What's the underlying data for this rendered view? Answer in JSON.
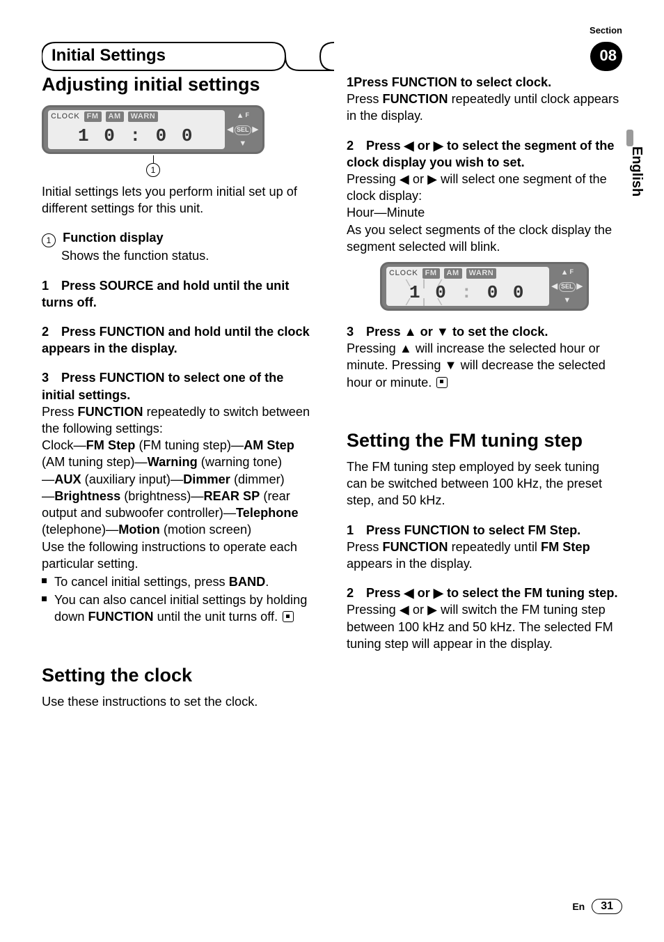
{
  "header": {
    "section_label": "Section",
    "title": "Initial Settings",
    "section_number": "08"
  },
  "language_tab": "English",
  "left": {
    "h_adjusting": "Adjusting initial settings",
    "lcd1": {
      "clock_label": "CLOCK",
      "chips": [
        "FM",
        "AM",
        "WARN"
      ],
      "time": "1 0 : 0 0",
      "sel": "SEL",
      "f": "F",
      "callout": "1"
    },
    "intro": "Initial settings lets you perform initial set up of different settings for this unit.",
    "fn_display_num": "1",
    "fn_display_title": "Function display",
    "fn_display_body": "Shows the function status.",
    "s1_n": "1",
    "s1": "Press SOURCE and hold until the unit turns off.",
    "s2_n": "2",
    "s2": "Press FUNCTION and hold until the clock appears in the display.",
    "s3_n": "3",
    "s3": "Press FUNCTION to select one of the initial settings.",
    "s3_body_a": "Press ",
    "s3_body_b": "FUNCTION",
    "s3_body_c": " repeatedly to switch between the following settings:",
    "chain": {
      "p1a": "Clock—",
      "p1b": "FM Step",
      "p1c": " (FM tuning step)—",
      "p1d": "AM Step",
      "p2a": "(AM tuning step)—",
      "p2b": "Warning",
      "p2c": " (warning tone)",
      "p3a": "—",
      "p3b": "AUX",
      "p3c": " (auxiliary input)—",
      "p3d": "Dimmer",
      "p3e": " (dimmer)",
      "p4a": "—",
      "p4b": "Brightness",
      "p4c": " (brightness)—",
      "p4d": "REAR SP",
      "p4e": " (rear",
      "p5a": "output and subwoofer controller)—",
      "p5b": "Telephone",
      "p6a": "(telephone)—",
      "p6b": "Motion",
      "p6c": " (motion screen)"
    },
    "use_following": "Use the following instructions to operate each particular setting.",
    "bullet1a": "To cancel initial settings, press ",
    "bullet1b": "BAND",
    "bullet1c": ".",
    "bullet2a": "You can also cancel initial settings by holding down ",
    "bullet2b": "FUNCTION",
    "bullet2c": " until the unit turns off.",
    "h_clock": "Setting the clock",
    "clock_intro": "Use these instructions to set the clock."
  },
  "right": {
    "r1_n": "1",
    "r1_t": "Press FUNCTION to select clock.",
    "r1_a": "Press ",
    "r1_b": "FUNCTION",
    "r1_c": " repeatedly until clock appears in the display.",
    "r2_n": "2",
    "r2_ta": "Press ",
    "r2_tl": "◀",
    "r2_tm": " or ",
    "r2_tr": "▶",
    "r2_tb": " to select the segment of the clock display you wish to set.",
    "r2_a": "Pressing ",
    "r2_b": " or ",
    "r2_c": " will select one segment of the clock display:",
    "r2_hm": "Hour—Minute",
    "r2_blink": "As you select segments of the clock display the segment selected will blink.",
    "lcd2": {
      "clock_label": "CLOCK",
      "chips": [
        "FM",
        "AM",
        "WARN"
      ],
      "time_left": "1 0",
      "time_right": "0 0",
      "sel": "SEL",
      "f": "F"
    },
    "r3_n": "3",
    "r3_ta": "Press ",
    "r3_tu": "▲",
    "r3_tm": " or ",
    "r3_td": "▼",
    "r3_tb": " to set the clock.",
    "r3_a": "Pressing ",
    "r3_b": " will increase the selected hour or minute. Pressing ",
    "r3_c": " will decrease the selected hour or minute.",
    "h_fm": "Setting the FM tuning step",
    "fm_intro": "The FM tuning step employed by seek tuning can be switched between 100 kHz, the preset step, and 50 kHz.",
    "f1_n": "1",
    "f1_t": "Press FUNCTION to select FM Step.",
    "f1_a": "Press ",
    "f1_b": "FUNCTION",
    "f1_c": " repeatedly until ",
    "f1_d": "FM Step",
    "f1_e": " appears in the display.",
    "f2_n": "2",
    "f2_ta": "Press ",
    "f2_tl": "◀",
    "f2_tm": " or ",
    "f2_tr": "▶",
    "f2_tb": " to select the FM tuning step.",
    "f2_a": "Pressing ",
    "f2_b": " or ",
    "f2_c": " will switch the FM tuning step between 100 kHz and 50 kHz. The selected FM tuning step will appear in the display."
  },
  "footer": {
    "lang": "En",
    "page": "31"
  }
}
